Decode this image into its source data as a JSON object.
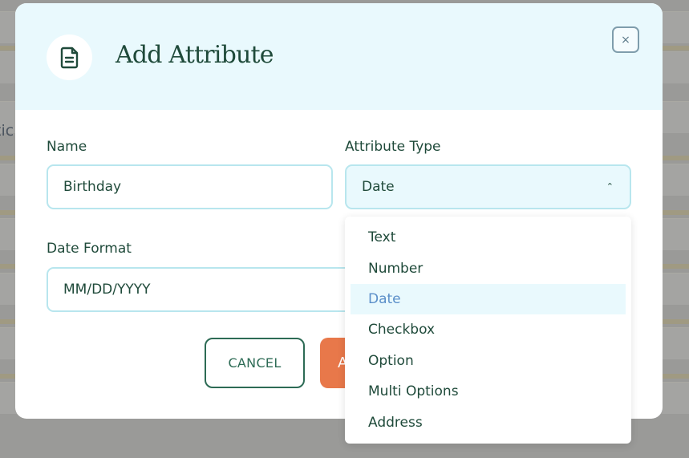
{
  "modal": {
    "title": "Add Attribute",
    "close_symbol": "×",
    "icon": "document-icon"
  },
  "form": {
    "name": {
      "label": "Name",
      "value": "Birthday"
    },
    "attribute_type": {
      "label": "Attribute Type",
      "value": "Date",
      "chevron": "⌃"
    },
    "date_format": {
      "label": "Date Format",
      "value": "MM/DD/YYYY"
    }
  },
  "buttons": {
    "cancel_label": "CANCEL",
    "add_label_partial": "A"
  },
  "dropdown": {
    "options": [
      "Text",
      "Number",
      "Date",
      "Checkbox",
      "Option",
      "Multi Options",
      "Address"
    ],
    "selected": "Date"
  },
  "background": {
    "partial_text": "tic"
  },
  "colors": {
    "header_bg": "#e9f9fd",
    "title_text": "#1f4a3a",
    "input_border": "#b8e6ee",
    "accent_orange": "#e8784a",
    "cancel_border": "#2d6b55",
    "selected_option_text": "#5b8fc9"
  }
}
